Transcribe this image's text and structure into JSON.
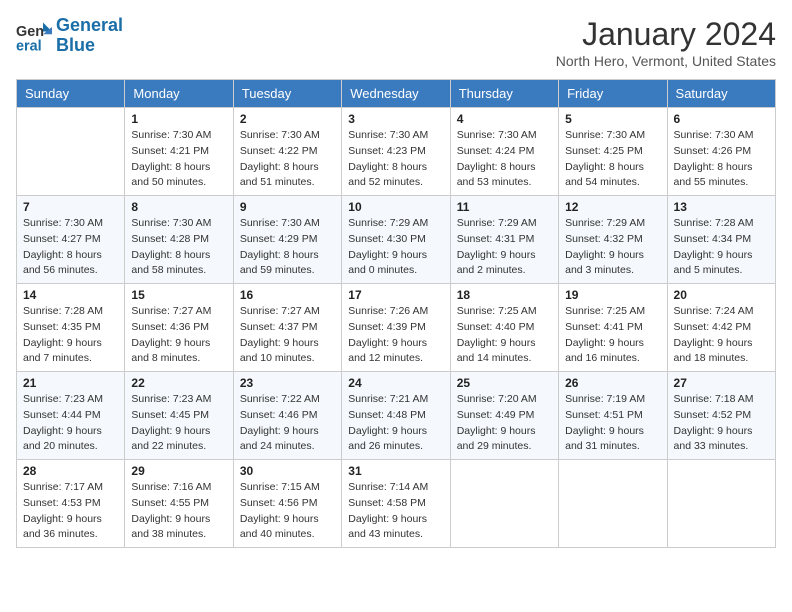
{
  "logo": {
    "line1": "General",
    "line2": "Blue"
  },
  "title": "January 2024",
  "subtitle": "North Hero, Vermont, United States",
  "weekdays": [
    "Sunday",
    "Monday",
    "Tuesday",
    "Wednesday",
    "Thursday",
    "Friday",
    "Saturday"
  ],
  "weeks": [
    [
      {
        "day": "",
        "sunrise": "",
        "sunset": "",
        "daylight": ""
      },
      {
        "day": "1",
        "sunrise": "Sunrise: 7:30 AM",
        "sunset": "Sunset: 4:21 PM",
        "daylight": "Daylight: 8 hours and 50 minutes."
      },
      {
        "day": "2",
        "sunrise": "Sunrise: 7:30 AM",
        "sunset": "Sunset: 4:22 PM",
        "daylight": "Daylight: 8 hours and 51 minutes."
      },
      {
        "day": "3",
        "sunrise": "Sunrise: 7:30 AM",
        "sunset": "Sunset: 4:23 PM",
        "daylight": "Daylight: 8 hours and 52 minutes."
      },
      {
        "day": "4",
        "sunrise": "Sunrise: 7:30 AM",
        "sunset": "Sunset: 4:24 PM",
        "daylight": "Daylight: 8 hours and 53 minutes."
      },
      {
        "day": "5",
        "sunrise": "Sunrise: 7:30 AM",
        "sunset": "Sunset: 4:25 PM",
        "daylight": "Daylight: 8 hours and 54 minutes."
      },
      {
        "day": "6",
        "sunrise": "Sunrise: 7:30 AM",
        "sunset": "Sunset: 4:26 PM",
        "daylight": "Daylight: 8 hours and 55 minutes."
      }
    ],
    [
      {
        "day": "7",
        "sunrise": "Sunrise: 7:30 AM",
        "sunset": "Sunset: 4:27 PM",
        "daylight": "Daylight: 8 hours and 56 minutes."
      },
      {
        "day": "8",
        "sunrise": "Sunrise: 7:30 AM",
        "sunset": "Sunset: 4:28 PM",
        "daylight": "Daylight: 8 hours and 58 minutes."
      },
      {
        "day": "9",
        "sunrise": "Sunrise: 7:30 AM",
        "sunset": "Sunset: 4:29 PM",
        "daylight": "Daylight: 8 hours and 59 minutes."
      },
      {
        "day": "10",
        "sunrise": "Sunrise: 7:29 AM",
        "sunset": "Sunset: 4:30 PM",
        "daylight": "Daylight: 9 hours and 0 minutes."
      },
      {
        "day": "11",
        "sunrise": "Sunrise: 7:29 AM",
        "sunset": "Sunset: 4:31 PM",
        "daylight": "Daylight: 9 hours and 2 minutes."
      },
      {
        "day": "12",
        "sunrise": "Sunrise: 7:29 AM",
        "sunset": "Sunset: 4:32 PM",
        "daylight": "Daylight: 9 hours and 3 minutes."
      },
      {
        "day": "13",
        "sunrise": "Sunrise: 7:28 AM",
        "sunset": "Sunset: 4:34 PM",
        "daylight": "Daylight: 9 hours and 5 minutes."
      }
    ],
    [
      {
        "day": "14",
        "sunrise": "Sunrise: 7:28 AM",
        "sunset": "Sunset: 4:35 PM",
        "daylight": "Daylight: 9 hours and 7 minutes."
      },
      {
        "day": "15",
        "sunrise": "Sunrise: 7:27 AM",
        "sunset": "Sunset: 4:36 PM",
        "daylight": "Daylight: 9 hours and 8 minutes."
      },
      {
        "day": "16",
        "sunrise": "Sunrise: 7:27 AM",
        "sunset": "Sunset: 4:37 PM",
        "daylight": "Daylight: 9 hours and 10 minutes."
      },
      {
        "day": "17",
        "sunrise": "Sunrise: 7:26 AM",
        "sunset": "Sunset: 4:39 PM",
        "daylight": "Daylight: 9 hours and 12 minutes."
      },
      {
        "day": "18",
        "sunrise": "Sunrise: 7:25 AM",
        "sunset": "Sunset: 4:40 PM",
        "daylight": "Daylight: 9 hours and 14 minutes."
      },
      {
        "day": "19",
        "sunrise": "Sunrise: 7:25 AM",
        "sunset": "Sunset: 4:41 PM",
        "daylight": "Daylight: 9 hours and 16 minutes."
      },
      {
        "day": "20",
        "sunrise": "Sunrise: 7:24 AM",
        "sunset": "Sunset: 4:42 PM",
        "daylight": "Daylight: 9 hours and 18 minutes."
      }
    ],
    [
      {
        "day": "21",
        "sunrise": "Sunrise: 7:23 AM",
        "sunset": "Sunset: 4:44 PM",
        "daylight": "Daylight: 9 hours and 20 minutes."
      },
      {
        "day": "22",
        "sunrise": "Sunrise: 7:23 AM",
        "sunset": "Sunset: 4:45 PM",
        "daylight": "Daylight: 9 hours and 22 minutes."
      },
      {
        "day": "23",
        "sunrise": "Sunrise: 7:22 AM",
        "sunset": "Sunset: 4:46 PM",
        "daylight": "Daylight: 9 hours and 24 minutes."
      },
      {
        "day": "24",
        "sunrise": "Sunrise: 7:21 AM",
        "sunset": "Sunset: 4:48 PM",
        "daylight": "Daylight: 9 hours and 26 minutes."
      },
      {
        "day": "25",
        "sunrise": "Sunrise: 7:20 AM",
        "sunset": "Sunset: 4:49 PM",
        "daylight": "Daylight: 9 hours and 29 minutes."
      },
      {
        "day": "26",
        "sunrise": "Sunrise: 7:19 AM",
        "sunset": "Sunset: 4:51 PM",
        "daylight": "Daylight: 9 hours and 31 minutes."
      },
      {
        "day": "27",
        "sunrise": "Sunrise: 7:18 AM",
        "sunset": "Sunset: 4:52 PM",
        "daylight": "Daylight: 9 hours and 33 minutes."
      }
    ],
    [
      {
        "day": "28",
        "sunrise": "Sunrise: 7:17 AM",
        "sunset": "Sunset: 4:53 PM",
        "daylight": "Daylight: 9 hours and 36 minutes."
      },
      {
        "day": "29",
        "sunrise": "Sunrise: 7:16 AM",
        "sunset": "Sunset: 4:55 PM",
        "daylight": "Daylight: 9 hours and 38 minutes."
      },
      {
        "day": "30",
        "sunrise": "Sunrise: 7:15 AM",
        "sunset": "Sunset: 4:56 PM",
        "daylight": "Daylight: 9 hours and 40 minutes."
      },
      {
        "day": "31",
        "sunrise": "Sunrise: 7:14 AM",
        "sunset": "Sunset: 4:58 PM",
        "daylight": "Daylight: 9 hours and 43 minutes."
      },
      {
        "day": "",
        "sunrise": "",
        "sunset": "",
        "daylight": ""
      },
      {
        "day": "",
        "sunrise": "",
        "sunset": "",
        "daylight": ""
      },
      {
        "day": "",
        "sunrise": "",
        "sunset": "",
        "daylight": ""
      }
    ]
  ]
}
